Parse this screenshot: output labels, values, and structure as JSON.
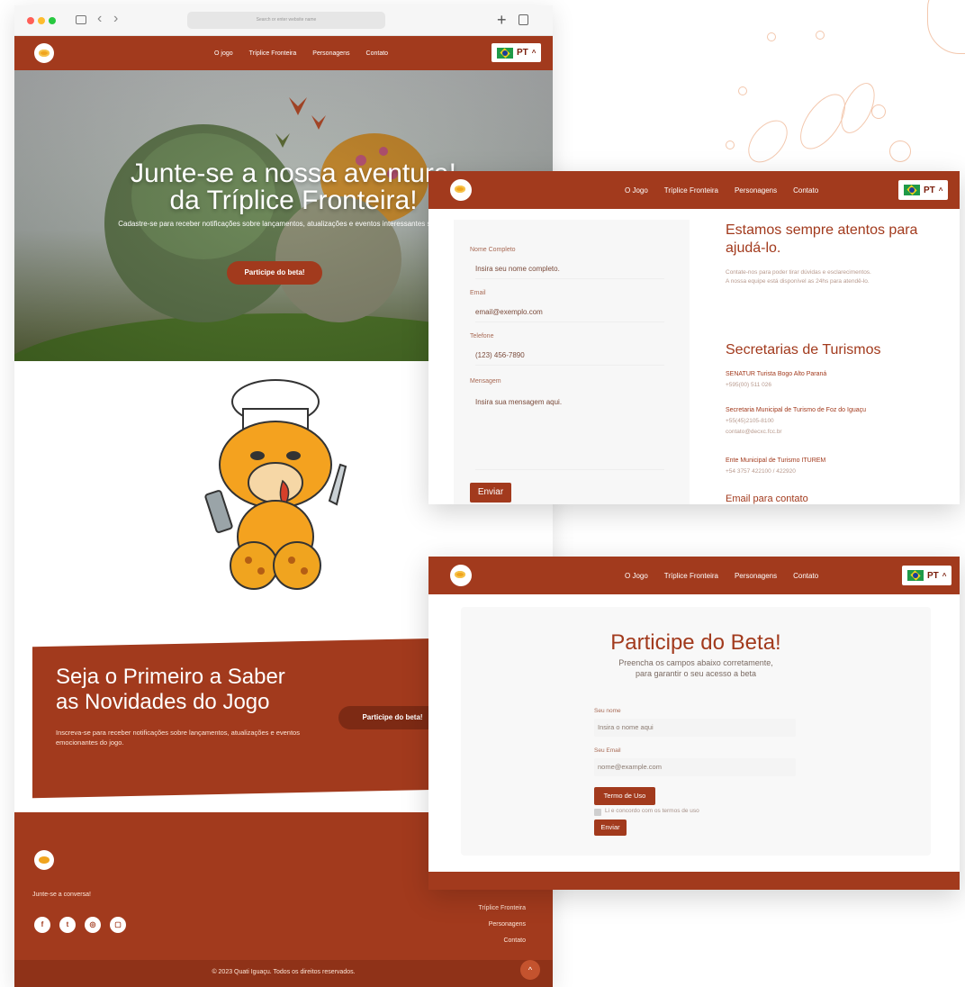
{
  "browser": {
    "address_placeholder": "Search or enter website name",
    "plus_symbol": "+",
    "back_symbol": "‹",
    "forward_symbol": "›"
  },
  "nav_main": {
    "links": [
      "O jogo",
      "Tríplice Fronteira",
      "Personagens",
      "Contato"
    ],
    "lang": "PT"
  },
  "nav_secondary": {
    "links": [
      "O Jogo",
      "Tríplice Fronteira",
      "Personagens",
      "Contato"
    ],
    "lang": "PT"
  },
  "hero": {
    "title_line1": "Junte-se a nossa aventura!",
    "title_line2": "da Tríplice Fronteira!",
    "subtitle": "Cadastre-se para receber notificações sobre lançamentos, atualizações e eventos interessantes sobre o jogo.",
    "cta": "Participe do beta!"
  },
  "newsletter": {
    "title_line1": "Seja o Primeiro a Saber",
    "title_line2": "as Novidades do Jogo",
    "text": "Inscreva-se para receber notificações sobre lançamentos, atualizações e eventos emocionantes do jogo.",
    "cta": "Participe do beta!"
  },
  "footer": {
    "tagline": "Junte-se a conversa!",
    "links": [
      "Tríplice Fronteira",
      "Personagens",
      "Contato"
    ],
    "copyright": "© 2023 Quati Iguaçu. Todos os direitos reservados.",
    "social": [
      "f",
      "t",
      "◎",
      "▢"
    ]
  },
  "contact": {
    "fields": [
      {
        "label": "Nome Completo",
        "placeholder": "Insira seu nome completo."
      },
      {
        "label": "Email",
        "placeholder": "email@exemplo.com"
      },
      {
        "label": "Telefone",
        "placeholder": "(123) 456-7890"
      },
      {
        "label": "Mensagem",
        "placeholder": "Insira sua mensagem aqui."
      }
    ],
    "submit": "Enviar",
    "side_title": "Estamos sempre atentos para ajudá-lo.",
    "side_text1": "Contate-nos para poder tirar dúvidas e esclarecimentos.",
    "side_text2": "A nossa equipe está disponível as 24hs para atendê-lo.",
    "tourism_title": "Secretarias de Turismos",
    "tourism": [
      {
        "name": "SENATUR Turista Bogo Alto Paraná",
        "info": "+595(00) 511 026"
      },
      {
        "name": "Secretaria Municipal de Turismo de Foz do Iguaçu",
        "info": "+55(45)2105-8100",
        "extra": "contato@decxc.fcc.br"
      },
      {
        "name": "Ente Municipal de Turismo ITUREM",
        "info": "+54 3757 422100 / 422920"
      }
    ],
    "email_title": "Email para contato"
  },
  "beta": {
    "title": "Participe do Beta!",
    "subtitle_line1": "Preencha os campos abaixo corretamente,",
    "subtitle_line2": "para garantir o seu acesso a beta",
    "name_label": "Seu nome",
    "name_placeholder": "Insira o nome aqui",
    "email_label": "Seu Email",
    "email_placeholder": "nome@example.com",
    "terms_button": "Termo de Uso",
    "terms_check": "Li e concordo com os termos de uso",
    "submit": "Enviar"
  }
}
